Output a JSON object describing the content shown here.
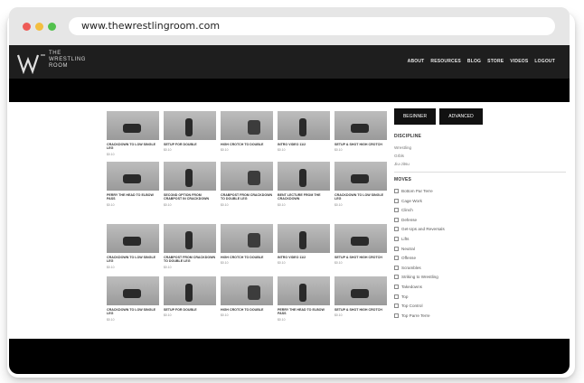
{
  "browser": {
    "url": "www.thewrestlingroom.com"
  },
  "site": {
    "logo_lines": [
      "THE",
      "WRESTLING",
      "ROOM"
    ],
    "nav": [
      "ABOUT",
      "RESOURCES",
      "BLOG",
      "STORE",
      "VIDEOS",
      "LOGOUT"
    ]
  },
  "videos": [
    {
      "title": "CRACKDOWN TO LOW SINGLE LEG",
      "price": "$0.10"
    },
    {
      "title": "SETUP FOR DOUBLE",
      "price": "$0.10"
    },
    {
      "title": "HIGH CROTCH TO DOUBLE",
      "price": "$0.10"
    },
    {
      "title": "INTRO VIDEO 11/2",
      "price": "$0.10"
    },
    {
      "title": "SETUP & SHOT HIGH CROTCH",
      "price": "$0.10"
    },
    {
      "title": "PERRY THE HEAD TO ELBOW PASS",
      "price": "$0.10"
    },
    {
      "title": "SECOND OPTION FROM CRABPOST IN CRACKDOWN",
      "price": "$0.10"
    },
    {
      "title": "CRABPOST FROM CRACKDOWN TO DOUBLE LEG",
      "price": "$0.10"
    },
    {
      "title": "BENT LECTURE FROM THE CRACKDOWN",
      "price": "$0.10"
    },
    {
      "title": "CRACKDOWN TO LOW SINGLE LEG",
      "price": "$0.10"
    },
    {
      "title": "CRACKDOWN TO LOW SINGLE LEG",
      "price": "$0.10"
    },
    {
      "title": "CRABPOST FROM CRACKDOWN TO DOUBLE LEG",
      "price": "$0.10"
    },
    {
      "title": "HIGH CROTCH TO DOUBLE",
      "price": "$0.10"
    },
    {
      "title": "INTRO VIDEO 11/2",
      "price": "$0.10"
    },
    {
      "title": "SETUP & SHOT HIGH CROTCH",
      "price": "$0.10"
    },
    {
      "title": "CRACKDOWN TO LOW SINGLE LEG",
      "price": "$0.10"
    },
    {
      "title": "SETUP FOR DOUBLE",
      "price": "$0.10"
    },
    {
      "title": "HIGH CROTCH TO DOUBLE",
      "price": "$0.10"
    },
    {
      "title": "PERRY THE HEAD TO ELBOW PASS",
      "price": "$0.10"
    },
    {
      "title": "SETUP & SHOT HIGH CROTCH",
      "price": "$0.10"
    }
  ],
  "filters": {
    "levels": [
      "BEGINNER",
      "ADVANCED"
    ],
    "discipline_title": "DISCIPLINE",
    "disciplines": [
      "Wrestling",
      "Grbls",
      "Jiu-Jitsu"
    ],
    "moves_title": "MOVES",
    "moves": [
      "Bottom Par Terre",
      "Cage Work",
      "Clinch",
      "Defense",
      "Get-Ups and Reversals",
      "Lifts",
      "Neutral",
      "Offense",
      "Scrambles",
      "Striking to Wrestling",
      "Takedowns",
      "Top",
      "Top Control",
      "Top Parre Terre"
    ]
  }
}
